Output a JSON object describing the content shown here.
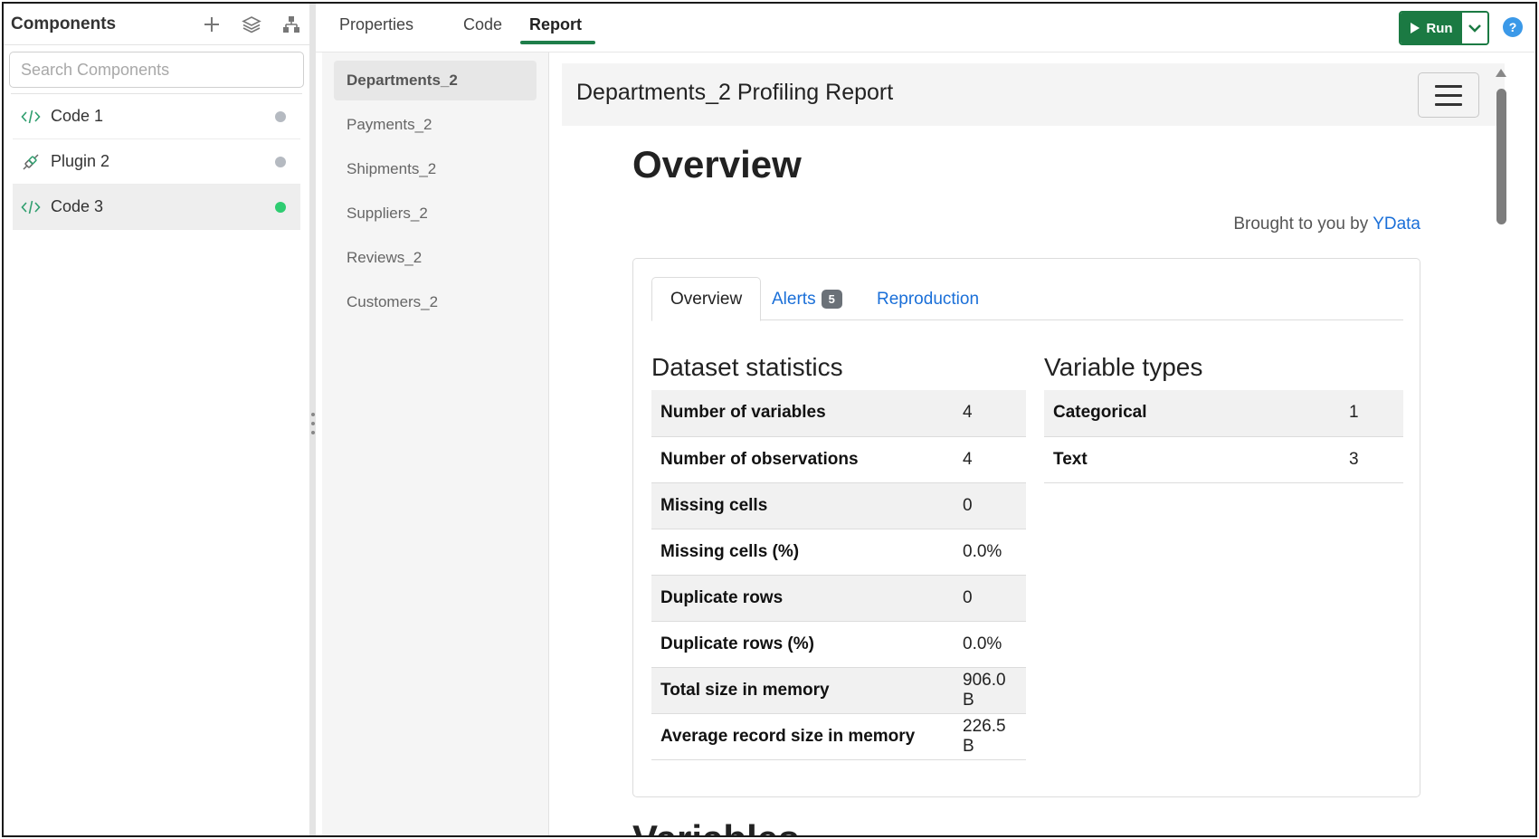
{
  "left_panel": {
    "title": "Components",
    "search_placeholder": "Search Components",
    "items": [
      {
        "label": "Code 1",
        "icon": "code-icon",
        "status": "idle"
      },
      {
        "label": "Plugin 2",
        "icon": "plugin-icon",
        "status": "idle"
      },
      {
        "label": "Code 3",
        "icon": "code-icon",
        "status": "success"
      }
    ]
  },
  "top_tabs": {
    "properties": "Properties",
    "code": "Code",
    "report": "Report",
    "active": "Report"
  },
  "toolbar": {
    "run_label": "Run",
    "help_label": "?"
  },
  "datasets": [
    "Departments_2",
    "Payments_2",
    "Shipments_2",
    "Suppliers_2",
    "Reviews_2",
    "Customers_2"
  ],
  "active_dataset": "Departments_2",
  "report": {
    "title": "Departments_2 Profiling Report",
    "heading": "Overview",
    "brought_prefix": "Brought to you by",
    "brought_link": "YData",
    "tabs": {
      "overview": "Overview",
      "alerts": "Alerts",
      "alerts_count": "5",
      "reproduction": "Reproduction"
    },
    "dataset_statistics": {
      "title": "Dataset statistics",
      "rows": [
        {
          "label": "Number of variables",
          "value": "4"
        },
        {
          "label": "Number of observations",
          "value": "4"
        },
        {
          "label": "Missing cells",
          "value": "0"
        },
        {
          "label": "Missing cells (%)",
          "value": "0.0%"
        },
        {
          "label": "Duplicate rows",
          "value": "0"
        },
        {
          "label": "Duplicate rows (%)",
          "value": "0.0%"
        },
        {
          "label": "Total size in memory",
          "value": "906.0 B"
        },
        {
          "label": "Average record size in memory",
          "value": "226.5 B"
        }
      ]
    },
    "variable_types": {
      "title": "Variable types",
      "rows": [
        {
          "label": "Categorical",
          "value": "1"
        },
        {
          "label": "Text",
          "value": "3"
        }
      ]
    },
    "next_section": "Variables"
  },
  "colors": {
    "accent_green": "#1b7a43",
    "link_blue": "#1a6fd8",
    "status_green": "#2ecc71",
    "status_gray": "#b5bac1"
  }
}
